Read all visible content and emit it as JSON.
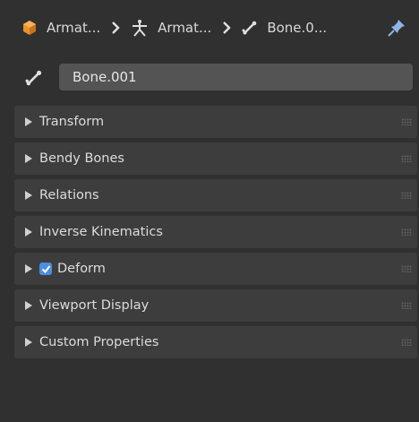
{
  "breadcrumb": {
    "items": [
      {
        "label": "Armat...",
        "icon": "armature-object-icon"
      },
      {
        "label": "Armat...",
        "icon": "armature-data-icon"
      },
      {
        "label": "Bone.0...",
        "icon": "bone-icon"
      }
    ],
    "pin_icon": "pin-icon"
  },
  "bone_name": {
    "value": "Bone.001",
    "icon": "bone-icon"
  },
  "panels": [
    {
      "label": "Transform"
    },
    {
      "label": "Bendy Bones"
    },
    {
      "label": "Relations"
    },
    {
      "label": "Inverse Kinematics"
    },
    {
      "label": "Deform",
      "checkbox": true
    },
    {
      "label": "Viewport Display"
    },
    {
      "label": "Custom Properties"
    }
  ],
  "colors": {
    "background": "#303030",
    "panel": "#3d3d3d",
    "field": "#545454",
    "checkbox_accent": "#4a8fe0",
    "object_orange": "#e8912f"
  }
}
